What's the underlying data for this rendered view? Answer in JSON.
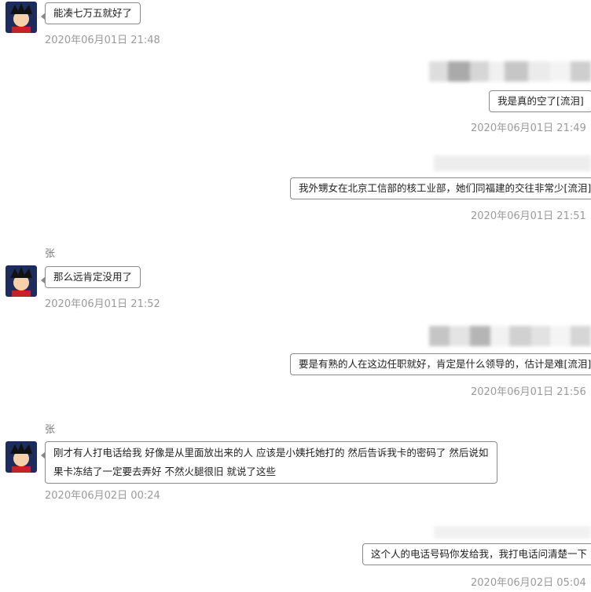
{
  "messages": [
    {
      "side": "left",
      "text": "能凑七万五就好了",
      "time": "2020年06月01日 21:48"
    },
    {
      "side": "right",
      "text": "我是真的空了[流泪]",
      "time": "2020年06月01日 21:49"
    },
    {
      "side": "right",
      "text": "我外甥女在北京工信部的核工业部，她们同福建的交往非常少[流泪]",
      "time": "2020年06月01日 21:51"
    },
    {
      "side": "left",
      "name": "张",
      "text": "那么远肯定没用了",
      "time": "2020年06月01日 21:52"
    },
    {
      "side": "right",
      "text": "要是有熟的人在这边任职就好，肯定是什么领导的，估计是难[流泪]",
      "time": "2020年06月01日 21:56"
    },
    {
      "side": "left",
      "name": "张",
      "text": "刚才有人打电话给我 好像是从里面放出来的人 应该是小姨托她打的 然后告诉我卡的密码了 然后说如果卡冻结了一定要去弄好 不然火腿很旧 就说了这些",
      "time": "2020年06月02日 00:24"
    },
    {
      "side": "right",
      "text": "这个人的电话号码你发给我，我打电话问清楚一下",
      "time": "2020年06月02日 05:04"
    }
  ],
  "colors": {
    "bubble_border": "#8a8a8a",
    "timestamp": "#9a9a9a",
    "background": "#ffffff"
  },
  "icons": {
    "avatar": "cartoon-avatar-icon"
  }
}
